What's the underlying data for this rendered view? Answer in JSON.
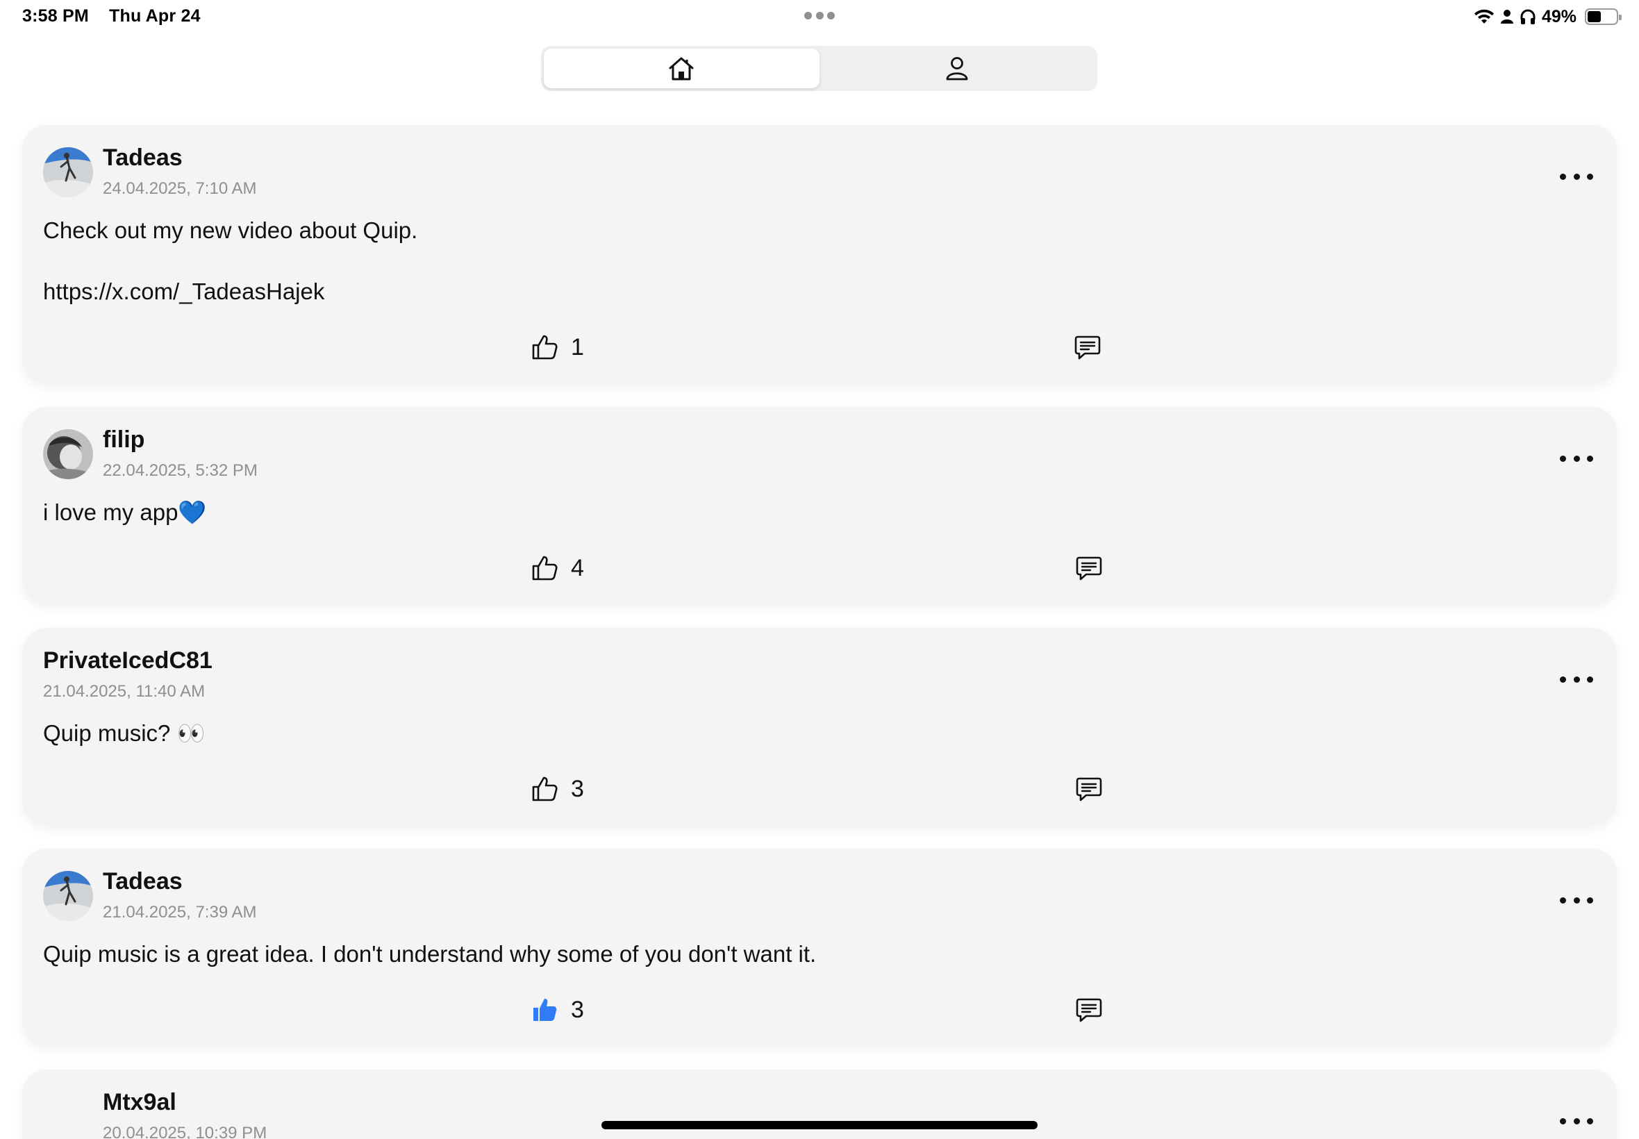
{
  "status_bar": {
    "time": "3:58 PM",
    "date": "Thu Apr 24",
    "battery_percent_label": "49%",
    "battery_level": 0.49,
    "icons": [
      "wifi-icon",
      "person-icon",
      "headphones-icon",
      "battery-icon"
    ]
  },
  "tabs": [
    {
      "name": "home",
      "icon": "home-icon",
      "selected": true
    },
    {
      "name": "profile",
      "icon": "person-icon",
      "selected": false
    }
  ],
  "colors": {
    "accent": "#2f7cf6",
    "card_background": "#f4f4f4",
    "secondary_text": "#8e8e93"
  },
  "posts": [
    {
      "author": "Tadeas",
      "timestamp": "24.04.2025, 7:10 AM",
      "body": "Check out my new video about Quip.\nhttps://x.com/_TadeasHajek",
      "likes": "1",
      "liked": false,
      "has_avatar": true
    },
    {
      "author": "filip",
      "timestamp": "22.04.2025, 5:32 PM",
      "body": "i love my app💙",
      "likes": "4",
      "liked": false,
      "has_avatar": true
    },
    {
      "author": "PrivateIcedC81",
      "timestamp": "21.04.2025, 11:40 AM",
      "body": "Quip music? 👀",
      "likes": "3",
      "liked": false,
      "has_avatar": false
    },
    {
      "author": "Tadeas",
      "timestamp": "21.04.2025, 7:39 AM",
      "body": "Quip music is a great idea. I don't understand why some of you don't want it.",
      "likes": "3",
      "liked": true,
      "has_avatar": true
    },
    {
      "author": "Mtx9al",
      "timestamp": "20.04.2025, 10:39 PM",
      "body": "",
      "likes": "",
      "liked": false,
      "has_avatar": false
    }
  ]
}
